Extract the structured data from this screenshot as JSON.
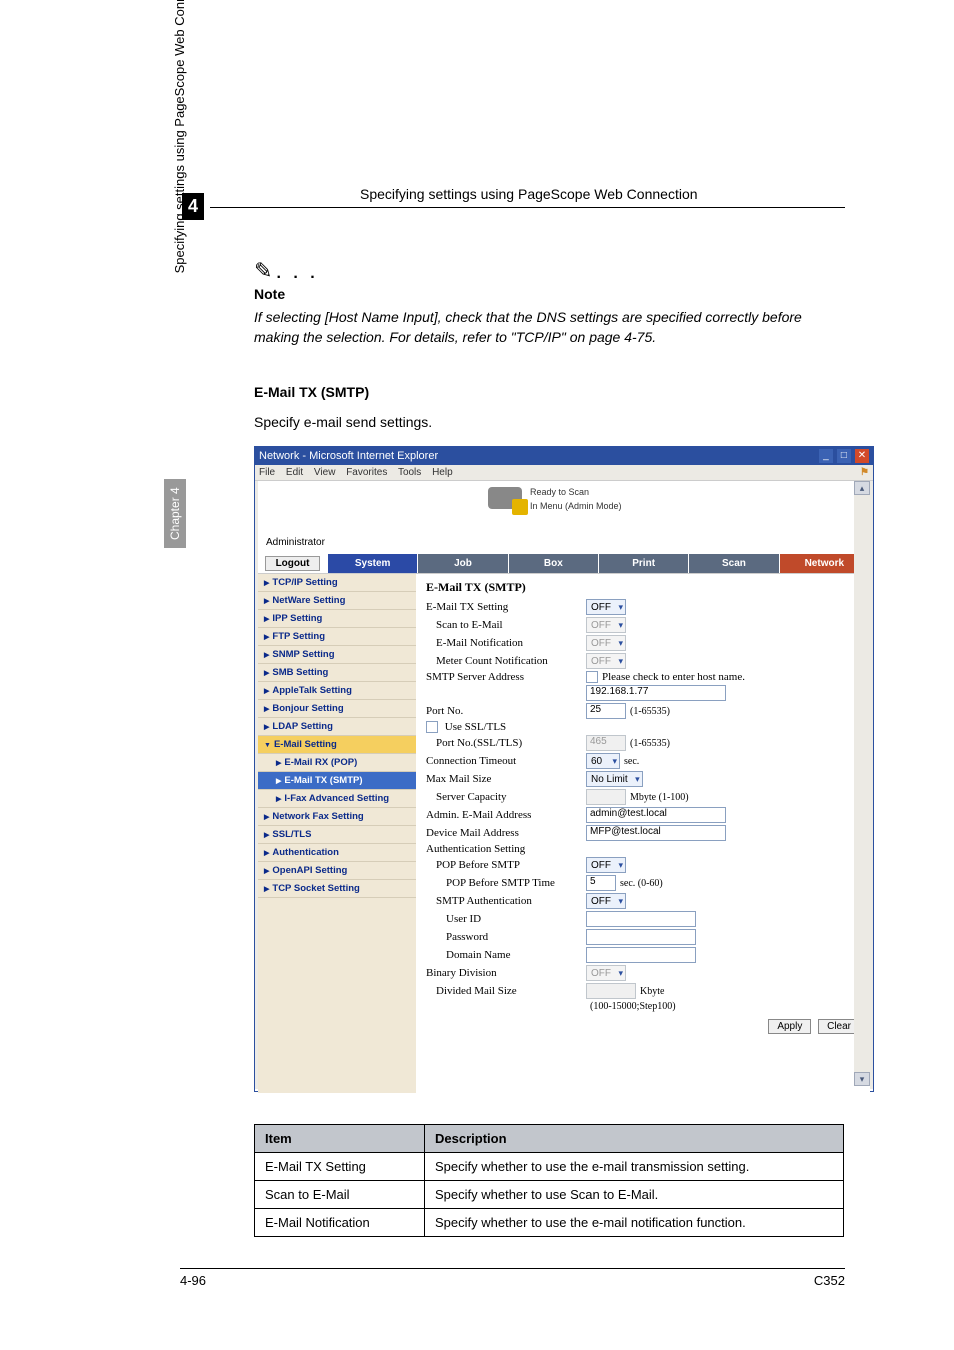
{
  "page": {
    "chapter_num": "4",
    "header": "Specifying settings using PageScope Web Connection",
    "side_label": "Specifying settings using PageScope Web Connection",
    "chapter_tab": "Chapter 4",
    "footer_left": "4-96",
    "footer_right": "C352"
  },
  "note": {
    "label": "Note",
    "body": "If selecting [Host Name Input], check that the DNS settings are specified correctly before making the selection. For details, refer to \"TCP/IP\" on page 4-75."
  },
  "section": {
    "heading": "E-Mail TX (SMTP)",
    "intro": "Specify e-mail send settings."
  },
  "ie": {
    "title": "Network - Microsoft Internet Explorer",
    "menu": {
      "file": "File",
      "edit": "Edit",
      "view": "View",
      "favorites": "Favorites",
      "tools": "Tools",
      "help": "Help"
    }
  },
  "pscope": {
    "status1": "Ready to Scan",
    "status2": "In Menu (Admin Mode)",
    "admin_label": "Administrator",
    "logout": "Logout",
    "tabs": {
      "system": "System",
      "job": "Job",
      "box": "Box",
      "print": "Print",
      "scan": "Scan",
      "network": "Network"
    },
    "sidebar": {
      "items": [
        "TCP/IP Setting",
        "NetWare Setting",
        "IPP Setting",
        "FTP Setting",
        "SNMP Setting",
        "SMB Setting",
        "AppleTalk Setting",
        "Bonjour Setting",
        "LDAP Setting"
      ],
      "open_item": "E-Mail Setting",
      "subs": [
        "E-Mail RX (POP)",
        "E-Mail TX (SMTP)",
        "I-Fax Advanced Setting"
      ],
      "selected_sub_index": 1,
      "after": [
        "Network Fax Setting",
        "SSL/TLS",
        "Authentication",
        "OpenAPI Setting",
        "TCP Socket Setting"
      ]
    },
    "form": {
      "title": "E-Mail TX (SMTP)",
      "rows": {
        "email_tx_setting": {
          "label": "E-Mail TX Setting",
          "value": "OFF"
        },
        "scan_to_email": {
          "label": "Scan to E-Mail",
          "value": "OFF"
        },
        "email_notification": {
          "label": "E-Mail Notification",
          "value": "OFF"
        },
        "meter_count": {
          "label": "Meter Count Notification",
          "value": "OFF"
        },
        "server_addr": {
          "label": "SMTP Server Address",
          "check": "Please check to enter host name.",
          "value": "192.168.1.77"
        },
        "port": {
          "label": "Port No.",
          "value": "25",
          "range": "(1-65535)"
        },
        "use_ssl": {
          "label": "Use SSL/TLS"
        },
        "port_ssl": {
          "label": "Port No.(SSL/TLS)",
          "value": "465",
          "range": "(1-65535)"
        },
        "timeout": {
          "label": "Connection Timeout",
          "value": "60",
          "unit": "sec."
        },
        "max_mail": {
          "label": "Max Mail Size",
          "value": "No Limit"
        },
        "capacity": {
          "label": "Server Capacity",
          "value": "",
          "unit": "Mbyte (1-100)"
        },
        "admin_addr": {
          "label": "Admin. E-Mail Address",
          "value": "admin@test.local"
        },
        "device_addr": {
          "label": "Device Mail Address",
          "value": "MFP@test.local"
        },
        "auth_setting": {
          "label": "Authentication Setting"
        },
        "pop_before": {
          "label": "POP Before SMTP",
          "value": "OFF"
        },
        "pop_time": {
          "label": "POP Before SMTP Time",
          "value": "5",
          "unit": "sec. (0-60)"
        },
        "smtp_auth": {
          "label": "SMTP Authentication",
          "value": "OFF"
        },
        "user_id": {
          "label": "User ID",
          "value": ""
        },
        "password": {
          "label": "Password",
          "value": ""
        },
        "domain": {
          "label": "Domain Name",
          "value": ""
        },
        "binary_div": {
          "label": "Binary Division",
          "value": "OFF"
        },
        "div_size": {
          "label": "Divided Mail Size",
          "value": "",
          "unit": "Kbyte",
          "range": "(100-15000;Step100)"
        }
      },
      "apply": "Apply",
      "clear": "Clear"
    }
  },
  "table": {
    "headers": {
      "item": "Item",
      "desc": "Description"
    },
    "rows": [
      {
        "item": "E-Mail TX Setting",
        "desc": "Specify whether to use the e-mail transmission setting."
      },
      {
        "item": "Scan to E-Mail",
        "desc": "Specify whether to use Scan to E-Mail."
      },
      {
        "item": "E-Mail Notification",
        "desc": "Specify whether to use the e-mail notification function."
      }
    ]
  }
}
